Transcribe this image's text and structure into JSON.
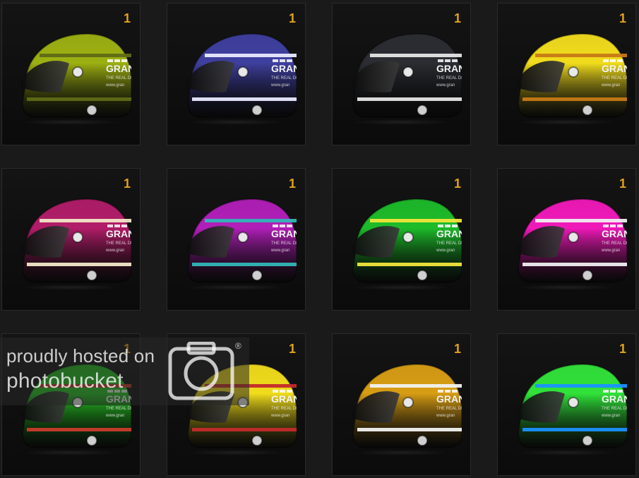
{
  "tiles": [
    {
      "count": "1",
      "body": "#9db012",
      "stripe": "#5f6a16"
    },
    {
      "count": "1",
      "body": "#3f3f9f",
      "stripe": "#e9e9ff"
    },
    {
      "count": "1",
      "body": "#2b2d32",
      "stripe": "#e6e6e6"
    },
    {
      "count": "1",
      "body": "#f1dc1c",
      "stripe": "#c77916"
    },
    {
      "count": "1",
      "body": "#b11d69",
      "stripe": "#f2e7c8"
    },
    {
      "count": "1",
      "body": "#b11fb8",
      "stripe": "#31b6b6"
    },
    {
      "count": "1",
      "body": "#1dbb2a",
      "stripe": "#f2e53b"
    },
    {
      "count": "1",
      "body": "#f019b9",
      "stripe": "#efefef"
    },
    {
      "count": "1",
      "body": "#26c222",
      "stripe": "#c93b2b"
    },
    {
      "count": "1",
      "body": "#f0dc1b",
      "stripe": "#c42b2b"
    },
    {
      "count": "1",
      "body": "#d79d14",
      "stripe": "#f2f2f2"
    },
    {
      "count": "1",
      "body": "#31e23a",
      "stripe": "#1b91ff"
    }
  ],
  "helmet": {
    "brand": "GRAN",
    "line1": "THE REAL DR",
    "line2": "www.gran"
  },
  "watermark": {
    "line1": "proudly hosted on",
    "line2": "photobucket",
    "reg": "®"
  },
  "colors": {
    "tile_bg": "#0b0b0b",
    "count": "#e0a21b",
    "page_bg": "#1a1a1a"
  }
}
